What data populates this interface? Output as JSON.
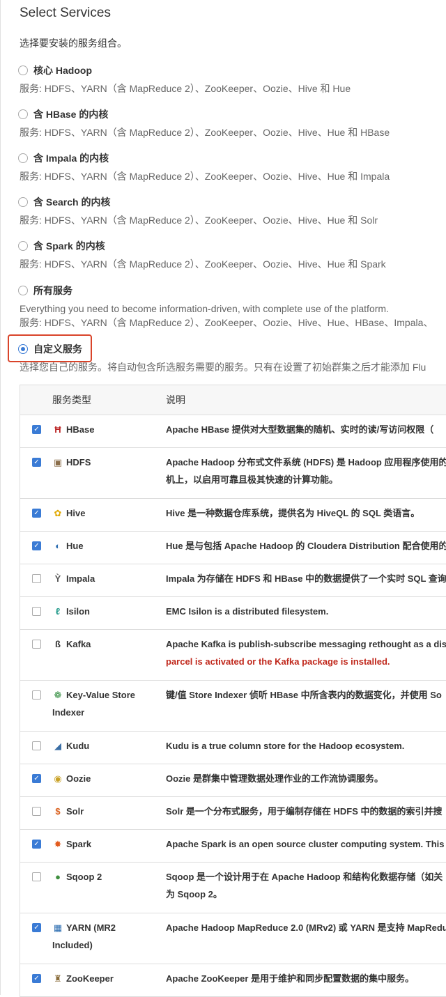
{
  "page": {
    "title": "Select Services",
    "subtitle": "选择要安装的服务组合。"
  },
  "options": [
    {
      "label": "核心 Hadoop",
      "desc": "服务: HDFS、YARN（含 MapReduce 2）、ZooKeeper、Oozie、Hive 和 Hue",
      "checked": false
    },
    {
      "label": "含 HBase 的内核",
      "desc": "服务: HDFS、YARN（含 MapReduce 2）、ZooKeeper、Oozie、Hive、Hue 和 HBase",
      "checked": false
    },
    {
      "label": "含 Impala 的内核",
      "desc": "服务: HDFS、YARN（含 MapReduce 2）、ZooKeeper、Oozie、Hive、Hue 和 Impala",
      "checked": false
    },
    {
      "label": "含 Search 的内核",
      "desc": "服务: HDFS、YARN（含 MapReduce 2）、ZooKeeper、Oozie、Hive、Hue 和 Solr",
      "checked": false
    },
    {
      "label": "含 Spark 的内核",
      "desc": "服务: HDFS、YARN（含 MapReduce 2）、ZooKeeper、Oozie、Hive、Hue 和 Spark",
      "checked": false
    },
    {
      "label": "所有服务",
      "desc": "Everything you need to become information-driven, with complete use of the platform.",
      "desc2": "服务: HDFS、YARN（含 MapReduce 2）、ZooKeeper、Oozie、Hive、Hue、HBase、Impala、",
      "checked": false
    },
    {
      "label": "自定义服务",
      "desc": "选择您自己的服务。将自动包含所选服务需要的服务。只有在设置了初始群集之后才能添加 Flu",
      "checked": true
    }
  ],
  "table": {
    "headers": {
      "type": "服务类型",
      "desc": "说明"
    },
    "rows": [
      {
        "name": "HBase",
        "icon": "hbase-icon",
        "glyph": "Ħ",
        "color": "#b22",
        "checked": true,
        "desc1": "Apache HBase 提供对大型数据集的随机、实时的读/写访问权限（",
        "desc2": ""
      },
      {
        "name": "HDFS",
        "icon": "hdfs-icon",
        "glyph": "▣",
        "color": "#8a6d4a",
        "checked": true,
        "desc1": "Apache Hadoop 分布式文件系统 (HDFS) 是 Hadoop 应用程序使用的",
        "desc2": "机上，以启用可靠且极其快速的计算功能。"
      },
      {
        "name": "Hive",
        "icon": "hive-icon",
        "glyph": "✿",
        "color": "#e0a800",
        "checked": true,
        "desc1": "Hive 是一种数据仓库系统，提供名为 HiveQL 的 SQL 类语言。",
        "desc2": ""
      },
      {
        "name": "Hue",
        "icon": "hue-icon",
        "glyph": "◐",
        "color": "#2b6cb0",
        "checked": true,
        "desc1": "Hue 是与包括 Apache Hadoop 的 Cloudera Distribution 配合使用的",
        "desc2": ""
      },
      {
        "name": "Impala",
        "icon": "impala-icon",
        "glyph": "Ỳ",
        "color": "#555",
        "checked": false,
        "desc1": "Impala 为存储在 HDFS 和 HBase 中的数据提供了一个实时 SQL 查询",
        "desc2": ""
      },
      {
        "name": "Isilon",
        "icon": "isilon-icon",
        "glyph": "ℓ",
        "color": "#2a9d8f",
        "checked": false,
        "desc1": "EMC Isilon is a distributed filesystem.",
        "desc2": ""
      },
      {
        "name": "Kafka",
        "icon": "kafka-icon",
        "glyph": "ß",
        "color": "#333",
        "checked": false,
        "desc1": "Apache Kafka is publish-subscribe messaging rethought as a dist",
        "desc2": "parcel is activated or the Kafka package is installed.",
        "warn": true
      },
      {
        "name": "Key-Value Store Indexer",
        "icon": "key-value-store-icon",
        "glyph": "❁",
        "color": "#2d8a3a",
        "checked": false,
        "desc1": "键/值 Store Indexer 侦听 HBase 中所含表内的数据变化，并使用 So",
        "desc2": ""
      },
      {
        "name": "Kudu",
        "icon": "kudu-icon",
        "glyph": "◢",
        "color": "#3a6ea5",
        "checked": false,
        "desc1": "Kudu is a true column store for the Hadoop ecosystem.",
        "desc2": ""
      },
      {
        "name": "Oozie",
        "icon": "oozie-icon",
        "glyph": "◉",
        "color": "#c9a227",
        "checked": true,
        "desc1": "Oozie 是群集中管理数据处理作业的工作流协调服务。",
        "desc2": ""
      },
      {
        "name": "Solr",
        "icon": "solr-icon",
        "glyph": "$",
        "color": "#d9601e",
        "checked": false,
        "desc1": "Solr 是一个分布式服务，用于编制存储在 HDFS 中的数据的索引并搜",
        "desc2": ""
      },
      {
        "name": "Spark",
        "icon": "spark-icon",
        "glyph": "✸",
        "color": "#e25a1c",
        "checked": true,
        "desc1": "Apache Spark is an open source cluster computing system. This s",
        "desc2": ""
      },
      {
        "name": "Sqoop 2",
        "icon": "sqoop-icon",
        "glyph": "●",
        "color": "#3f8f3f",
        "checked": false,
        "desc1": "Sqoop 是一个设计用于在 Apache Hadoop 和结构化数据存储（如关",
        "desc2": "为 Sqoop 2。"
      },
      {
        "name": "YARN (MR2 Included)",
        "icon": "yarn-icon",
        "glyph": "▦",
        "color": "#2b6cb0",
        "checked": true,
        "desc1": "Apache Hadoop MapReduce 2.0 (MRv2) 或 YARN 是支持 MapRedu",
        "desc2": ""
      },
      {
        "name": "ZooKeeper",
        "icon": "zookeeper-icon",
        "glyph": "♜",
        "color": "#8a6d3b",
        "checked": true,
        "desc1": "Apache ZooKeeper 是用于维护和同步配置数据的集中服务。",
        "desc2": ""
      }
    ]
  }
}
